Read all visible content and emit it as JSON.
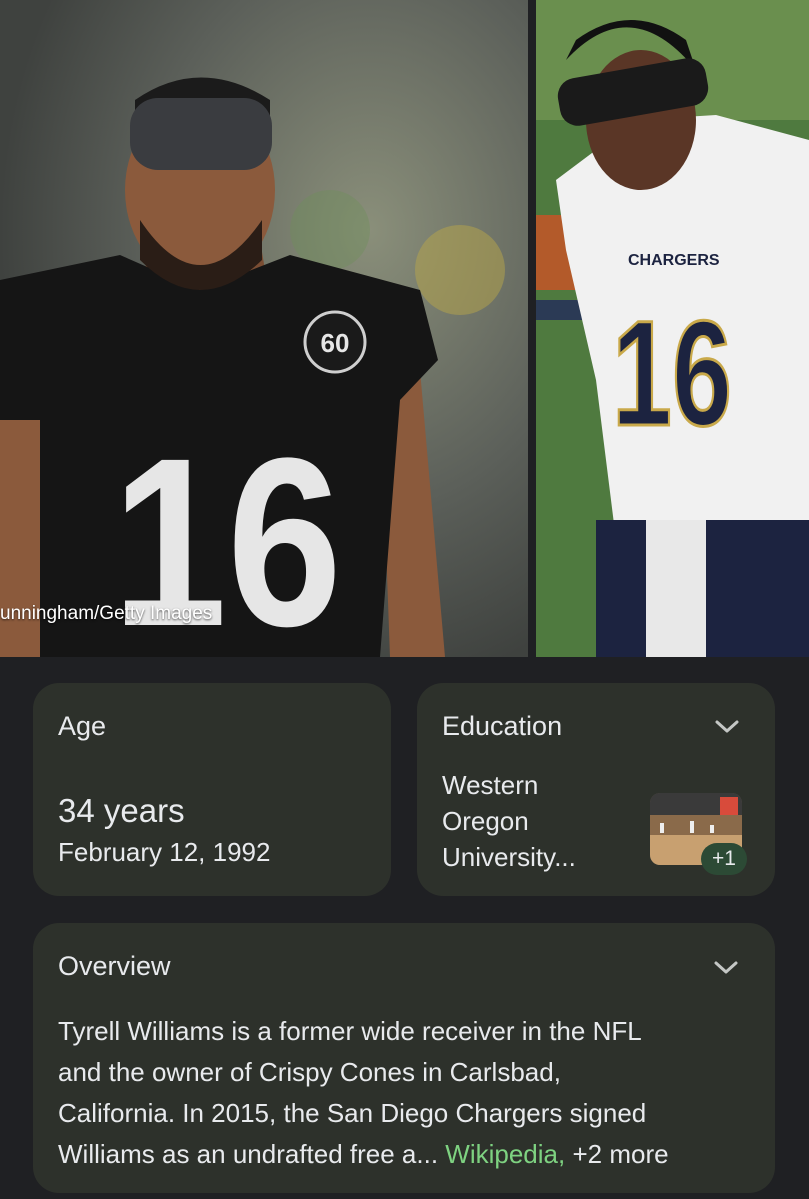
{
  "images": {
    "credit": "unningham/Getty Images",
    "left_jersey_number": "16",
    "left_patch": "60",
    "right_jersey_text": "CHARGERS",
    "right_jersey_number": "16"
  },
  "age_card": {
    "title": "Age",
    "value": "34 years",
    "birth_date": "February 12, 1992"
  },
  "education_card": {
    "title": "Education",
    "school_line1": "Western",
    "school_line2": "Oregon",
    "school_line3": "University...",
    "more_count": "+1"
  },
  "overview_card": {
    "title": "Overview",
    "line1": "Tyrell Williams is a former wide receiver in the NFL",
    "line2": "and the owner of Crispy Cones in Carlsbad,",
    "line3": "California. In 2015, the San Diego Chargers signed",
    "line4_text": "Williams as an undrafted free a...",
    "source_link": "Wikipedia,",
    "more_link": "+2 more"
  },
  "colors": {
    "page_bg": "#1f2023",
    "card_bg": "#2d312b",
    "link_green": "#7ed281",
    "badge_bg": "#2c4a35"
  },
  "icons": [
    "chevron-down-icon"
  ]
}
